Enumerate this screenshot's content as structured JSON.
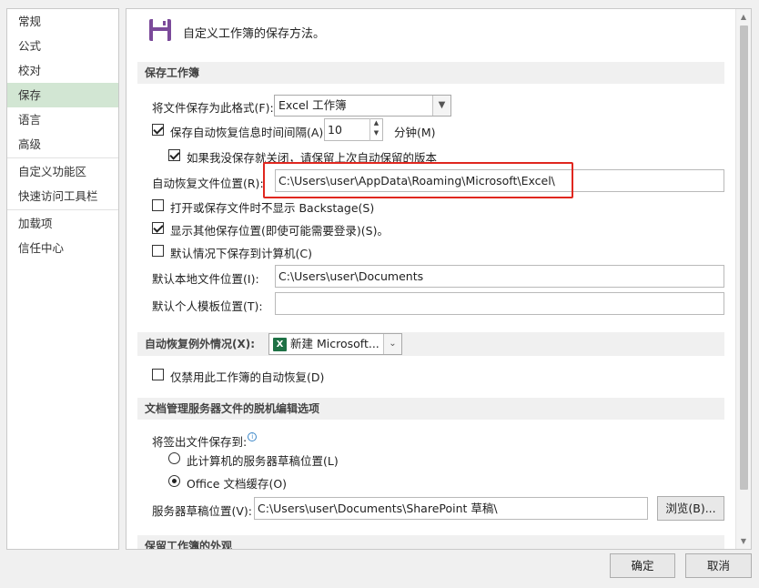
{
  "sidebar": {
    "items": [
      {
        "label": "常规"
      },
      {
        "label": "公式"
      },
      {
        "label": "校对"
      },
      {
        "label": "保存"
      },
      {
        "label": "语言"
      },
      {
        "label": "高级"
      },
      {
        "label": "自定义功能区"
      },
      {
        "label": "快速访问工具栏"
      },
      {
        "label": "加载项"
      },
      {
        "label": "信任中心"
      }
    ]
  },
  "header": {
    "title": "自定义工作簿的保存方法。",
    "icon": "floppy-disk-icon"
  },
  "save_section": {
    "title": "保存工作簿",
    "format_label": "将文件保存为此格式(F):",
    "format_value": "Excel 工作簿",
    "autorecover_label": "保存自动恢复信息时间间隔(A)",
    "autorecover_value": "10",
    "minutes_label": "分钟(M)",
    "keep_last_label": "如果我没保存就关闭，请保留上次自动保留的版本",
    "autorecover_location_label": "自动恢复文件位置(R):",
    "autorecover_location_value": "C:\\Users\\user\\AppData\\Roaming\\Microsoft\\Excel\\",
    "no_backstage_label": "打开或保存文件时不显示 Backstage(S)",
    "show_other_label": "显示其他保存位置(即使可能需要登录)(S)。",
    "default_computer_label": "默认情况下保存到计算机(C)",
    "default_local_label": "默认本地文件位置(I):",
    "default_local_value": "C:\\Users\\user\\Documents",
    "default_template_label": "默认个人模板位置(T):",
    "default_template_value": ""
  },
  "exceptions_section": {
    "title": "自动恢复例外情况(X):",
    "workbook_value": "新建 Microsoft...",
    "disable_label": "仅禁用此工作簿的自动恢复(D)"
  },
  "offline_section": {
    "title": "文档管理服务器文件的脱机编辑选项",
    "save_to_label": "将签出文件保存到:",
    "option_server_label": "此计算机的服务器草稿位置(L)",
    "option_office_label": "Office 文档缓存(O)",
    "drafts_label": "服务器草稿位置(V):",
    "drafts_value": "C:\\Users\\user\\Documents\\SharePoint 草稿\\",
    "browse_label": "浏览(B)..."
  },
  "appearance_section": {
    "title": "保留工作簿的外观"
  },
  "footer": {
    "ok_label": "确定",
    "cancel_label": "取消"
  },
  "colors": {
    "accent_nav": "#d2e6d3",
    "highlight_box": "#e0271f",
    "excel_green": "#1e7145"
  }
}
